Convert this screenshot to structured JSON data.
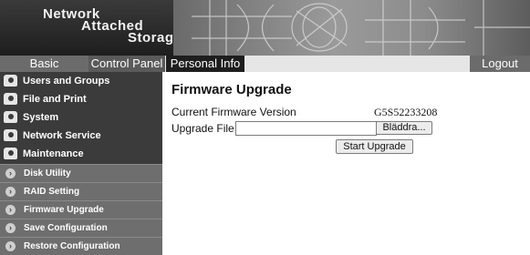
{
  "header": {
    "brand_line1": "Network",
    "brand_line2": "Attached",
    "brand_line3": "Storage"
  },
  "tabs": {
    "basic": "Basic",
    "control_panel": "Control Panel",
    "personal_info": "Personal Info",
    "logout": "Logout"
  },
  "sidebar": {
    "main_items": [
      {
        "label": "Users and Groups",
        "icon": "folder-user-icon"
      },
      {
        "label": "File and Print",
        "icon": "folder-user-icon"
      },
      {
        "label": "System",
        "icon": "folder-user-icon"
      },
      {
        "label": "Network Service",
        "icon": "folder-user-icon"
      },
      {
        "label": "Maintenance",
        "icon": "folder-user-icon"
      }
    ],
    "sub_items": [
      {
        "label": "Disk Utility",
        "icon": "chevron-right-icon"
      },
      {
        "label": "RAID Setting",
        "icon": "chevron-right-icon"
      },
      {
        "label": "Firmware Upgrade",
        "icon": "chevron-right-icon"
      },
      {
        "label": "Save Configuration",
        "icon": "chevron-right-icon"
      },
      {
        "label": "Restore Configuration",
        "icon": "chevron-right-icon"
      }
    ]
  },
  "main": {
    "title": "Firmware Upgrade",
    "current_fw_label": "Current Firmware Version",
    "current_fw_value": "G5S52233208",
    "upgrade_file_label": "Upgrade File",
    "upgrade_file_value": "",
    "browse_label": "Bläddra...",
    "start_label": "Start Upgrade"
  },
  "colors": {
    "sidebar_dark": "#3b3b3b",
    "sidebar_sub": "#6e6e6e",
    "tab_active": "#1e1e1e"
  }
}
